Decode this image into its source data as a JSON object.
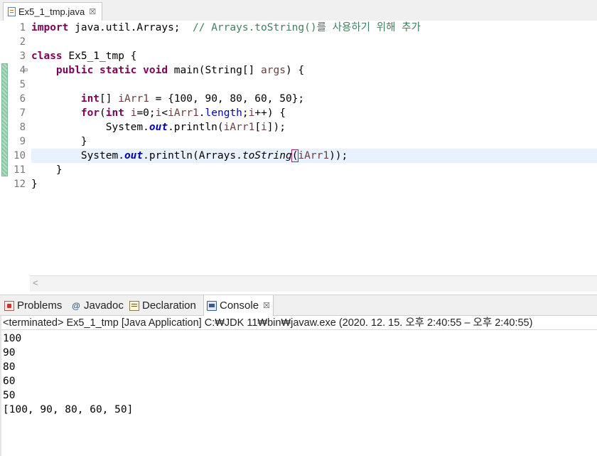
{
  "editor_tab": {
    "label": "Ex5_1_tmp.java",
    "close": "☒"
  },
  "line_numbers": [
    "1",
    "2",
    "3",
    "4",
    "5",
    "6",
    "7",
    "8",
    "9",
    "10",
    "11",
    "12"
  ],
  "fold_marker": "⊖",
  "code": {
    "l1_kw": "import",
    "l1_rest": " java.util.Arrays;  ",
    "l1_comment": "// Arrays.toString()를 사용하기 위해 추가",
    "l3_kw": "class",
    "l3_rest": " Ex5_1_tmp {",
    "l4_kw": "public static void",
    "l4_rest": " main(String[] ",
    "l4_var": "args",
    "l4_end": ") {",
    "l6_kw": "int",
    "l6_a": "[] ",
    "l6_var": "iArr1",
    "l6_b": " = {100, 90, 80, 60, 50};",
    "l7_kw": "for",
    "l7_a": "(",
    "l7_kw2": "int",
    "l7_b": " ",
    "l7_var1": "i",
    "l7_c": "=0;",
    "l7_var2": "i",
    "l7_d": "<",
    "l7_var3": "iArr1",
    "l7_e": ".",
    "l7_field": "length",
    "l7_f": ";",
    "l7_var4": "i",
    "l7_g": "++) {",
    "l8_a": "System.",
    "l8_field": "out",
    "l8_b": ".println(",
    "l8_var1": "iArr1",
    "l8_c": "[",
    "l8_var2": "i",
    "l8_d": "]);",
    "l9": "}",
    "l10_a": "System.",
    "l10_field": "out",
    "l10_b": ".println(Arrays.",
    "l10_static": "toString",
    "l10_paren": "(",
    "l10_var": "iArr1",
    "l10_c": "));",
    "l11": "}",
    "l12": "}"
  },
  "panel_tabs": {
    "problems": "Problems",
    "javadoc": "Javadoc",
    "declaration": "Declaration",
    "console": "Console",
    "console_close": "☒",
    "javadoc_glyph": "@"
  },
  "console": {
    "status": "<terminated> Ex5_1_tmp [Java Application] C:₩JDK 11₩bin₩javaw.exe  (2020. 12. 15. 오후 2:40:55 – 오후 2:40:55)",
    "output": [
      "100",
      "90",
      "80",
      "60",
      "50",
      "[100, 90, 80, 60, 50]"
    ]
  },
  "scroll_glyph": "<"
}
